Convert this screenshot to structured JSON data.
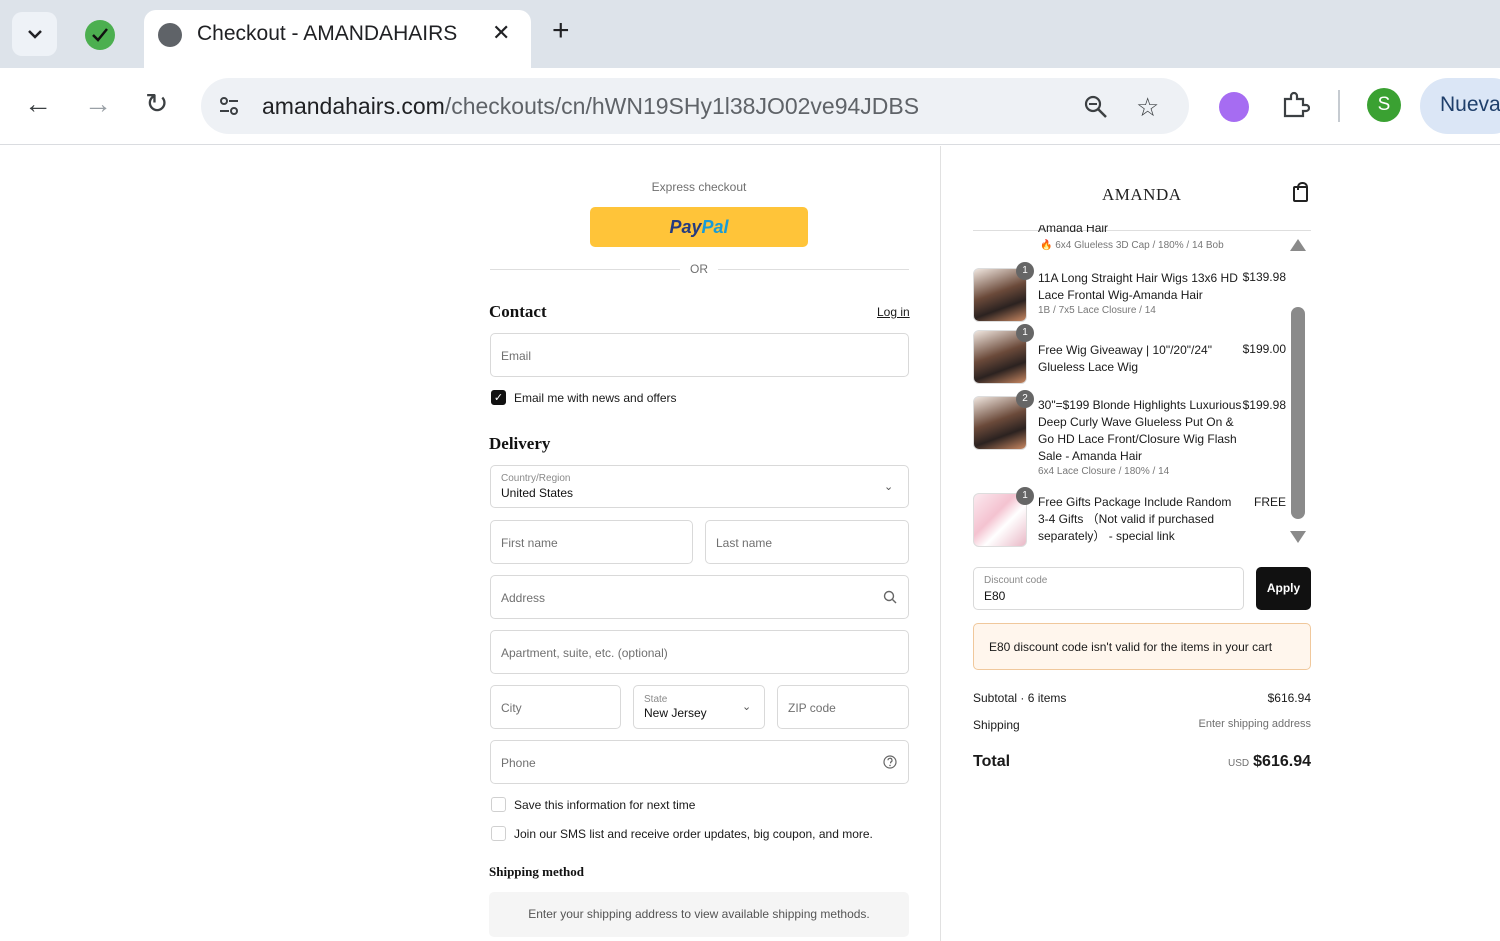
{
  "browser": {
    "tab_title": "Checkout - AMANDAHAIRS",
    "url_domain": "amandahairs.com",
    "url_path": "/checkouts/cn/hWN19SHy1l38JO02ve94JDBS",
    "profile_initial": "S",
    "profile_label": "Nueva"
  },
  "checkout": {
    "express_label": "Express checkout",
    "paypal_1": "Pay",
    "paypal_2": "Pal",
    "or_label": "OR",
    "contact_heading": "Contact",
    "login_link": "Log in",
    "email_placeholder": "Email",
    "email_optin_label": "Email me with news and offers",
    "email_optin_checked": true,
    "delivery_heading": "Delivery",
    "country_label": "Country/Region",
    "country_value": "United States",
    "first_name_placeholder": "First name",
    "last_name_placeholder": "Last name",
    "address_placeholder": "Address",
    "apartment_placeholder": "Apartment, suite, etc. (optional)",
    "city_placeholder": "City",
    "state_label": "State",
    "state_value": "New Jersey",
    "zip_placeholder": "ZIP code",
    "phone_placeholder": "Phone",
    "save_info_label": "Save this information for next time",
    "sms_label": "Join our SMS list and receive order updates, big coupon, and more.",
    "shipping_method_heading": "Shipping method",
    "shipping_method_note": "Enter your shipping address to view available shipping methods."
  },
  "summary": {
    "brand": "AMANDA",
    "partial_item_name": "Amanda Hair",
    "partial_item_variant": "6x4 Glueless 3D Cap / 180% / 14 Bob",
    "items": [
      {
        "qty": "1",
        "name": "11A Long Straight Hair Wigs 13x6 HD Lace Frontal Wig-Amanda Hair",
        "variant": "1B / 7x5 Lace Closure / 14",
        "price": "$139.98"
      },
      {
        "qty": "1",
        "name": "Free Wig Giveaway | 10\"/20\"/24\" Glueless Lace Wig",
        "variant": "",
        "price": "$199.00"
      },
      {
        "qty": "2",
        "name": "30\"=$199 Blonde Highlights Luxurious Deep Curly Wave Glueless Put On & Go HD Lace Front/Closure Wig Flash Sale - Amanda Hair",
        "variant": "6x4 Lace Closure / 180% / 14",
        "price": "$199.98"
      },
      {
        "qty": "1",
        "name": "Free Gifts Package Include Random 3-4 Gifts （Not valid if purchased separately） - special link",
        "variant": "",
        "price": "FREE"
      }
    ],
    "discount_label": "Discount code",
    "discount_value": "E80",
    "apply_label": "Apply",
    "alert_text": "E80 discount code isn't valid for the items in your cart",
    "subtotal_label": "Subtotal · 6 items",
    "subtotal_value": "$616.94",
    "shipping_label": "Shipping",
    "shipping_value": "Enter shipping address",
    "total_label": "Total",
    "currency": "USD",
    "total_value": "$616.94"
  }
}
